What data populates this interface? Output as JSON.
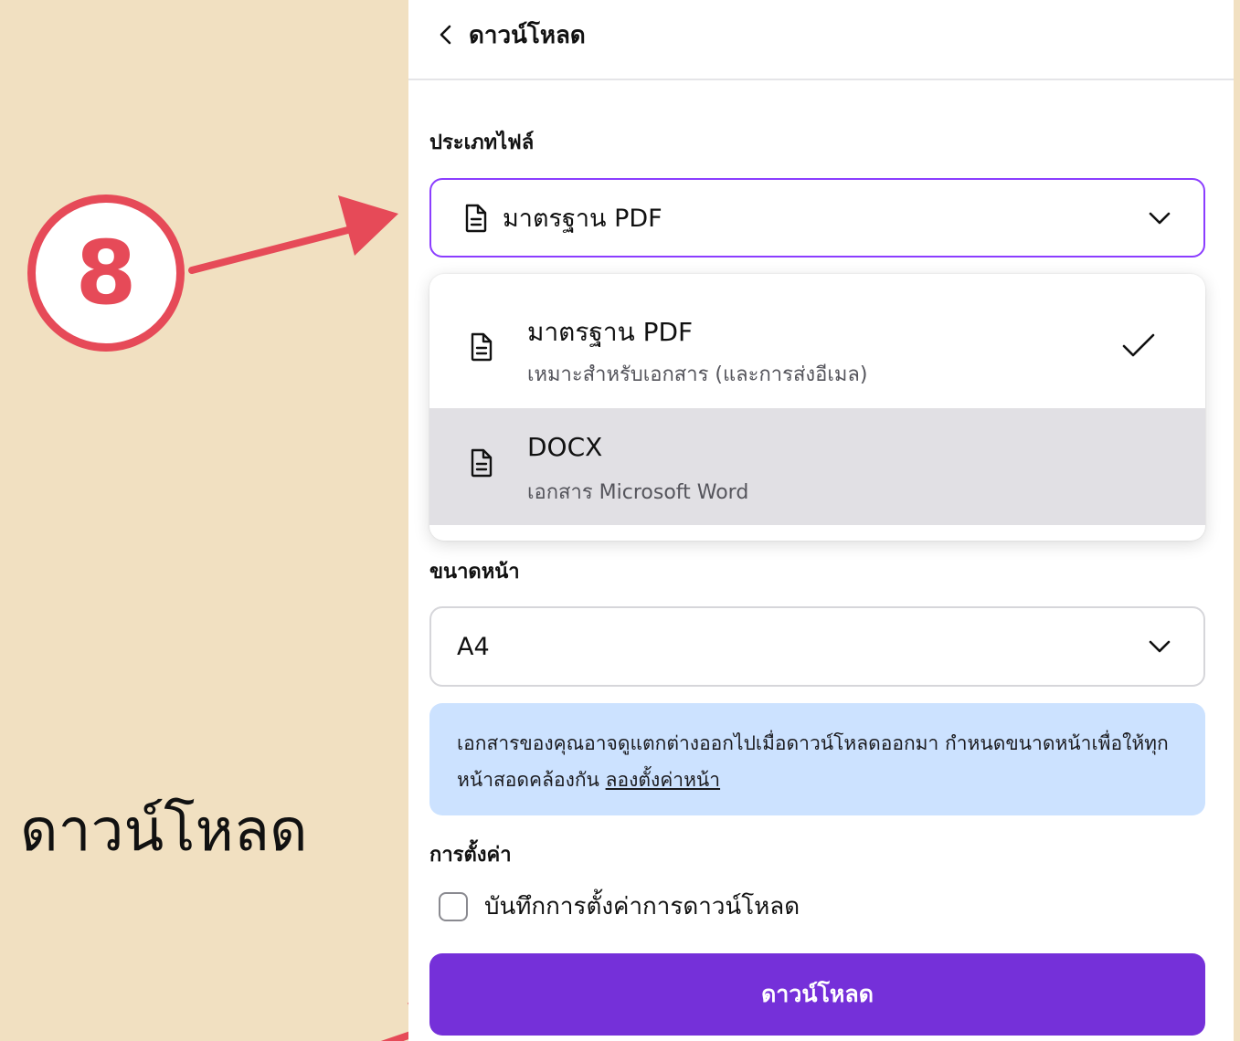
{
  "annotation": {
    "step_number": "8",
    "caption": "ดาวน์โหลด",
    "accent_color": "#E64A58"
  },
  "header": {
    "title": "ดาวน์โหลด",
    "back_icon": "chevron-left-icon"
  },
  "file_type": {
    "label": "ประเภทไฟล์",
    "selected": "มาตรฐาน PDF",
    "icon": "document-icon",
    "options": [
      {
        "title": "มาตรฐาน PDF",
        "description": "เหมาะสำหรับเอกสาร (และการส่งอีเมล)",
        "selected": true
      },
      {
        "title": "DOCX",
        "description": "เอกสาร Microsoft Word",
        "selected": false,
        "hovered": true
      }
    ]
  },
  "page_size": {
    "label": "ขนาดหน้า",
    "selected": "A4"
  },
  "info": {
    "text": "เอกสารของคุณอาจดูแตกต่างออกไปเมื่อดาวน์โหลดออกมา กำหนดขนาดหน้าเพื่อให้ทุกหน้าสอดคล้องกัน",
    "link": "ลองตั้งค่าหน้า",
    "background_color": "#CCE2FF"
  },
  "settings": {
    "label": "การตั้งค่า",
    "save_checkbox_label": "บันทึกการตั้งค่าการดาวน์โหลด",
    "save_checked": false
  },
  "download_button": {
    "label": "ดาวน์โหลด",
    "color": "#7530D9"
  },
  "colors": {
    "background": "#F1E0C1",
    "accent_purple": "#8B3DFF"
  }
}
